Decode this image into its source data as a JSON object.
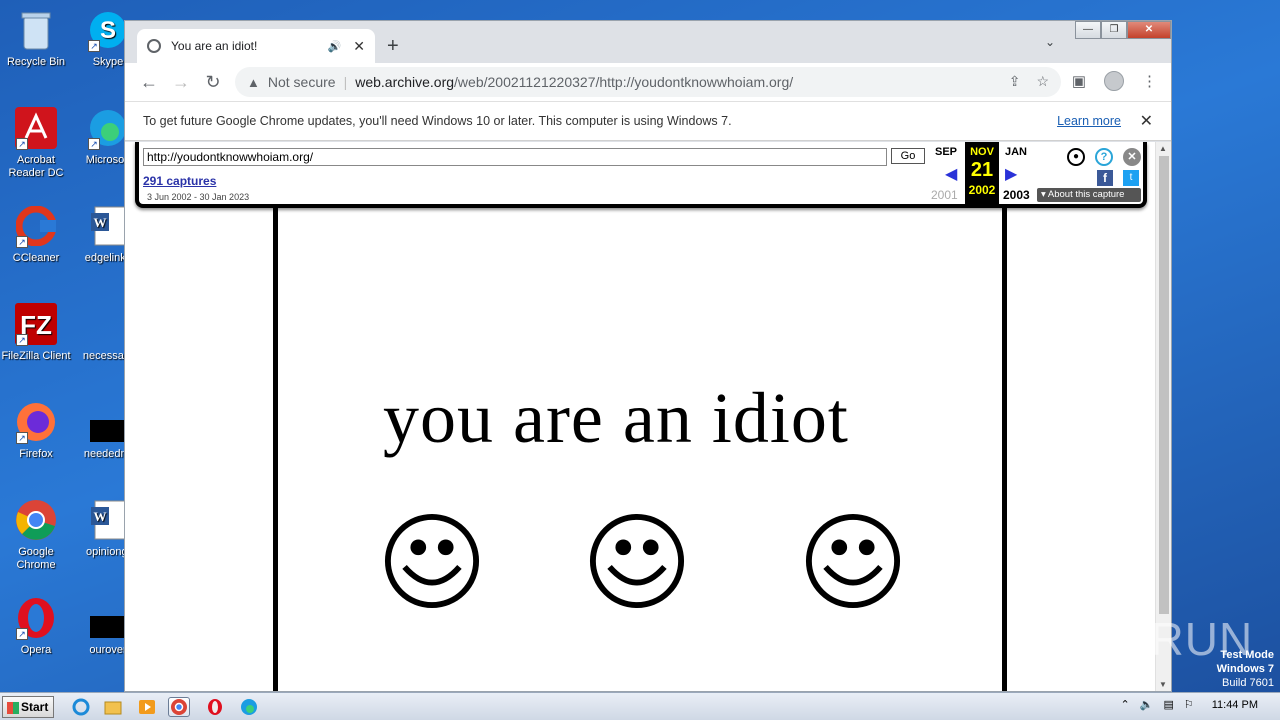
{
  "desktop": {
    "icons": [
      {
        "label": "Recycle Bin"
      },
      {
        "label": "Skype"
      },
      {
        "label": "Acrobat Reader DC"
      },
      {
        "label": "Microsoft"
      },
      {
        "label": "CCleaner"
      },
      {
        "label": "edgelinks"
      },
      {
        "label": "FileZilla Client"
      },
      {
        "label": "necessary"
      },
      {
        "label": "Firefox"
      },
      {
        "label": "neededny"
      },
      {
        "label": "Google Chrome"
      },
      {
        "label": "opiniongi"
      },
      {
        "label": "Opera"
      },
      {
        "label": "ourover"
      }
    ]
  },
  "browser": {
    "tab_title": "You are an idiot!",
    "address": {
      "security": "Not secure",
      "host": "web.archive.org",
      "path": "/web/20021121220327/http://youdontknowwhoiam.org/"
    },
    "infobar": {
      "message": "To get future Google Chrome updates, you'll need Windows 10 or later. This computer is using Windows 7.",
      "learn_more": "Learn more"
    }
  },
  "wayback": {
    "url": "http://youdontknowwhoiam.org/",
    "go": "Go",
    "captures": "291 captures",
    "range": "3 Jun 2002 - 30 Jan 2023",
    "prev_month": "SEP",
    "cur_month": "NOV",
    "cur_day": "21",
    "cur_year": "2002",
    "next_month": "JAN",
    "prev_year": "2001",
    "next_year": "2003",
    "about": "About this capture"
  },
  "page": {
    "headline": "you are an idiot"
  },
  "taskbar": {
    "start": "Start",
    "time": "11:44 PM"
  },
  "watermark": "ANY RUN",
  "testmode": {
    "line1": "Test Mode",
    "line2": "Windows 7",
    "line3": "Build 7601"
  }
}
